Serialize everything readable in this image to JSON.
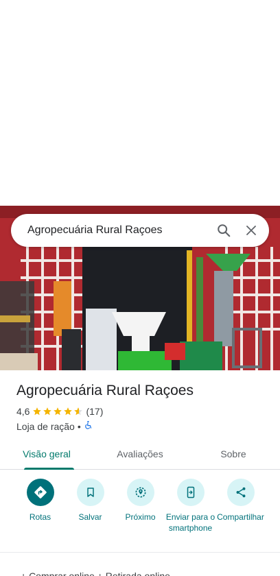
{
  "search": {
    "query": "Agropecuária Rural Raçoes"
  },
  "place": {
    "name": "Agropecuária Rural Raçoes",
    "rating": "4,6",
    "rating_value": 4.6,
    "review_count": "(17)",
    "category": "Loja de ração",
    "separator": "•"
  },
  "tabs": [
    {
      "label": "Visão geral",
      "active": true
    },
    {
      "label": "Avaliações",
      "active": false
    },
    {
      "label": "Sobre",
      "active": false
    }
  ],
  "actions": [
    {
      "label": "Rotas",
      "icon": "directions-icon"
    },
    {
      "label": "Salvar",
      "icon": "bookmark-icon"
    },
    {
      "label": "Próximo",
      "icon": "nearby-icon"
    },
    {
      "label": "Enviar para o smartphone",
      "icon": "send-to-phone-icon"
    },
    {
      "label": "Compartilhar",
      "icon": "share-icon"
    }
  ],
  "bottom_peek": "+ Comprar online  + Retirada online",
  "colors": {
    "accent": "#00717a",
    "tab_accent": "#00796b",
    "action_bg": "#d7f4f6",
    "star": "#f4b400",
    "accessibility": "#1a73e8"
  }
}
